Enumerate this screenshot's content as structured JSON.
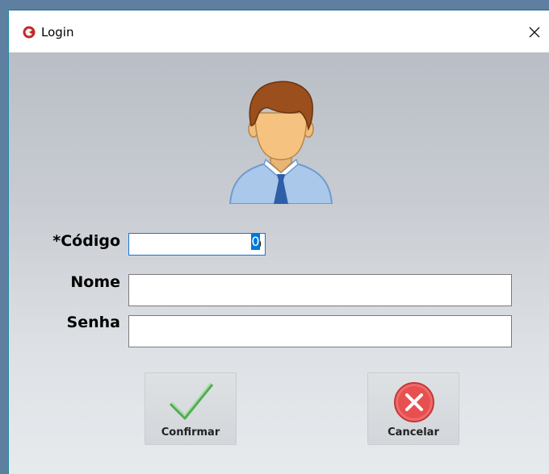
{
  "window": {
    "title": "Login",
    "icons": {
      "app": "app-logo-icon",
      "close": "close-icon"
    }
  },
  "form": {
    "avatar_icon": "user-avatar-icon",
    "codigo_label": "*Código",
    "codigo_value": "0",
    "nome_label": "Nome",
    "nome_value": "",
    "senha_label": "Senha",
    "senha_value": ""
  },
  "buttons": {
    "confirm_label": "Confirmar",
    "confirm_icon": "checkmark-icon",
    "cancel_label": "Cancelar",
    "cancel_icon": "cancel-x-icon"
  },
  "colors": {
    "accent": "#0078d7",
    "confirm_green": "#5cb85c",
    "cancel_red": "#e04848"
  }
}
